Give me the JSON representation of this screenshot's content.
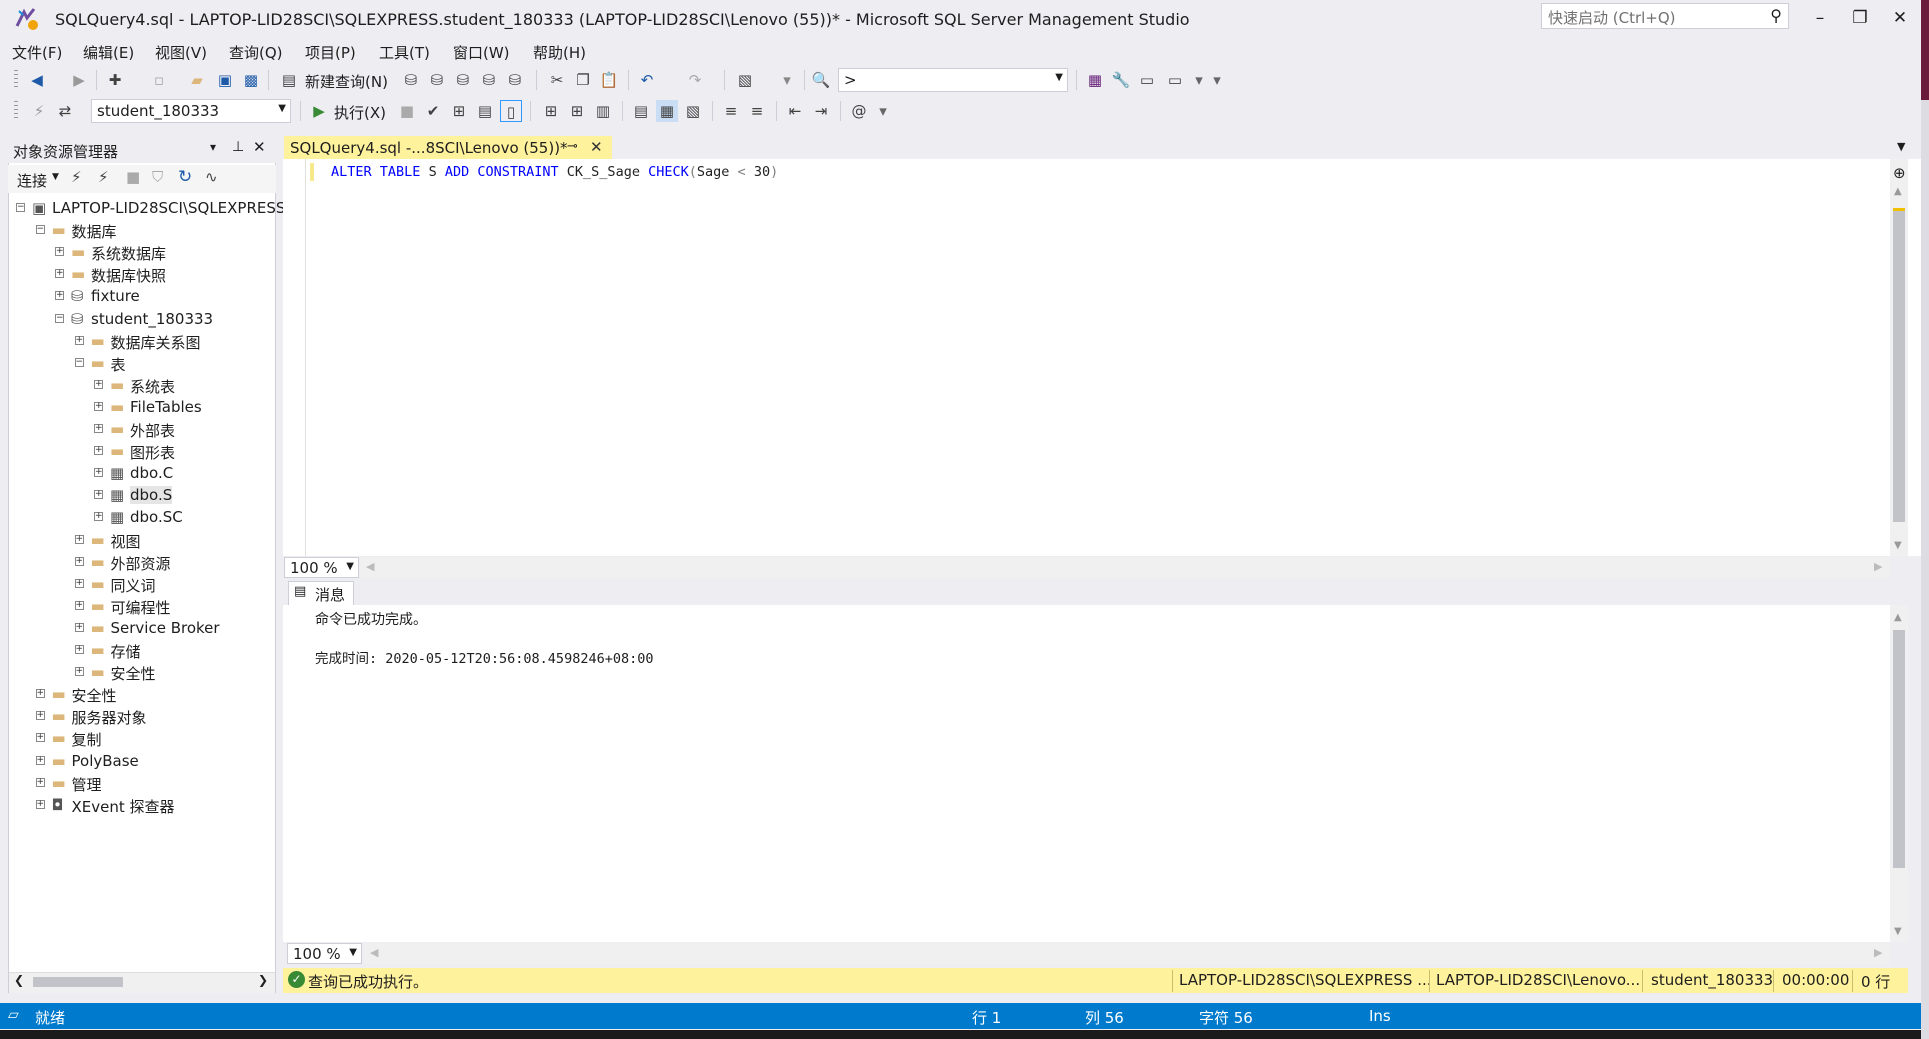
{
  "window": {
    "title": "SQLQuery4.sql - LAPTOP-LID28SCI\\SQLEXPRESS.student_180333 (LAPTOP-LID28SCI\\Lenovo (55))* - Microsoft SQL Server Management Studio",
    "quick_launch_placeholder": "快速启动 (Ctrl+Q)",
    "minimize": "–",
    "restore": "❐",
    "close": "✕"
  },
  "menu": [
    "文件(F)",
    "编辑(E)",
    "视图(V)",
    "查询(Q)",
    "项目(P)",
    "工具(T)",
    "窗口(W)",
    "帮助(H)"
  ],
  "toolbar1": {
    "new_query_label": "新建查询(N)",
    "find_combo_value": ">"
  },
  "toolbar2": {
    "database_combo_value": "student_180333",
    "execute_label": "执行(X)"
  },
  "object_explorer": {
    "title": "对象资源管理器",
    "connect_label": "连接",
    "tree": [
      {
        "label": "LAPTOP-LID28SCI\\SQLEXPRESS",
        "level": 0,
        "expanded": true,
        "icon": "server-icon"
      },
      {
        "label": "数据库",
        "level": 1,
        "expanded": true,
        "icon": "folder-icon"
      },
      {
        "label": "系统数据库",
        "level": 2,
        "expanded": false,
        "icon": "folder-icon"
      },
      {
        "label": "数据库快照",
        "level": 2,
        "expanded": false,
        "icon": "folder-icon"
      },
      {
        "label": "fixture",
        "level": 2,
        "expanded": false,
        "icon": "database-icon"
      },
      {
        "label": "student_180333",
        "level": 2,
        "expanded": true,
        "icon": "database-icon"
      },
      {
        "label": "数据库关系图",
        "level": 3,
        "expanded": false,
        "icon": "folder-icon"
      },
      {
        "label": "表",
        "level": 3,
        "expanded": true,
        "icon": "folder-icon"
      },
      {
        "label": "系统表",
        "level": 4,
        "expanded": false,
        "icon": "folder-icon"
      },
      {
        "label": "FileTables",
        "level": 4,
        "expanded": false,
        "icon": "folder-icon"
      },
      {
        "label": "外部表",
        "level": 4,
        "expanded": false,
        "icon": "folder-icon"
      },
      {
        "label": "图形表",
        "level": 4,
        "expanded": false,
        "icon": "folder-icon"
      },
      {
        "label": "dbo.C",
        "level": 4,
        "expanded": false,
        "icon": "table-icon"
      },
      {
        "label": "dbo.S",
        "level": 4,
        "expanded": false,
        "icon": "table-icon",
        "selected": true
      },
      {
        "label": "dbo.SC",
        "level": 4,
        "expanded": false,
        "icon": "table-icon"
      },
      {
        "label": "视图",
        "level": 3,
        "expanded": false,
        "icon": "folder-icon"
      },
      {
        "label": "外部资源",
        "level": 3,
        "expanded": false,
        "icon": "folder-icon"
      },
      {
        "label": "同义词",
        "level": 3,
        "expanded": false,
        "icon": "folder-icon"
      },
      {
        "label": "可编程性",
        "level": 3,
        "expanded": false,
        "icon": "folder-icon"
      },
      {
        "label": "Service Broker",
        "level": 3,
        "expanded": false,
        "icon": "folder-icon"
      },
      {
        "label": "存储",
        "level": 3,
        "expanded": false,
        "icon": "folder-icon"
      },
      {
        "label": "安全性",
        "level": 3,
        "expanded": false,
        "icon": "folder-icon"
      },
      {
        "label": "安全性",
        "level": 1,
        "expanded": false,
        "icon": "folder-icon"
      },
      {
        "label": "服务器对象",
        "level": 1,
        "expanded": false,
        "icon": "folder-icon"
      },
      {
        "label": "复制",
        "level": 1,
        "expanded": false,
        "icon": "folder-icon"
      },
      {
        "label": "PolyBase",
        "level": 1,
        "expanded": false,
        "icon": "folder-icon"
      },
      {
        "label": "管理",
        "level": 1,
        "expanded": false,
        "icon": "folder-icon"
      },
      {
        "label": "XEvent 探查器",
        "level": 1,
        "expanded": false,
        "icon": "xevent-icon"
      }
    ]
  },
  "editor": {
    "tab_title": "SQLQuery4.sql -...8SCI\\Lenovo (55))*",
    "sql": {
      "kw1": "ALTER",
      "kw2": "TABLE",
      "table": "S",
      "kw3": "ADD",
      "kw4": "CONSTRAINT",
      "name": "CK_S_Sage",
      "kw5": "CHECK",
      "lparen": "(",
      "col": "Sage",
      "op": "<",
      "num": "30",
      "rparen": ")"
    },
    "zoom": "100 %"
  },
  "results": {
    "tab_label": "消息",
    "line1": "命令已成功完成。",
    "line2": "完成时间: 2020-05-12T20:56:08.4598246+08:00",
    "zoom": "100 %"
  },
  "query_status": {
    "message": "查询已成功执行。",
    "server": "LAPTOP-LID28SCI\\SQLEXPRESS ...",
    "user": "LAPTOP-LID28SCI\\Lenovo...",
    "database": "student_180333",
    "elapsed": "00:00:00",
    "rows": "0 行"
  },
  "status_bar": {
    "ready": "就绪",
    "line": "行 1",
    "col": "列 56",
    "char": "字符 56",
    "mode": "Ins"
  },
  "colors": {
    "accent": "#007acc",
    "tab_yellow": "#fff29d",
    "keyword_blue": "#0000ff"
  }
}
